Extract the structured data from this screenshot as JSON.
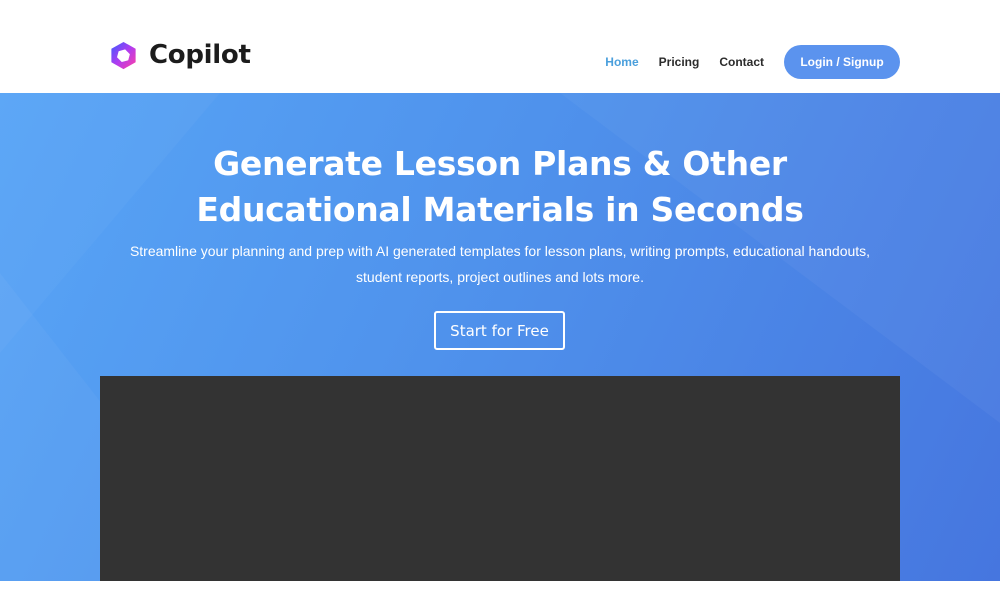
{
  "brand": {
    "name": "Copilot",
    "logo_icon": "copilot-logo-icon"
  },
  "nav": {
    "items": [
      {
        "label": "Home",
        "active": true
      },
      {
        "label": "Pricing",
        "active": false
      },
      {
        "label": "Contact",
        "active": false
      }
    ],
    "cta_label": "Login / Signup"
  },
  "hero": {
    "title": "Generate Lesson Plans & Other Educational Materials in Seconds",
    "subtitle": "Streamline your planning and prep with AI generated templates for lesson plans, writing prompts, educational handouts, student reports, project outlines and lots more.",
    "cta_label": "Start for Free"
  },
  "colors": {
    "accent": "#5b93ee",
    "active_nav": "#4a9fdc",
    "hero_gradient_start": "#58a5f6",
    "hero_gradient_end": "#4676df",
    "video_background": "#333333"
  }
}
